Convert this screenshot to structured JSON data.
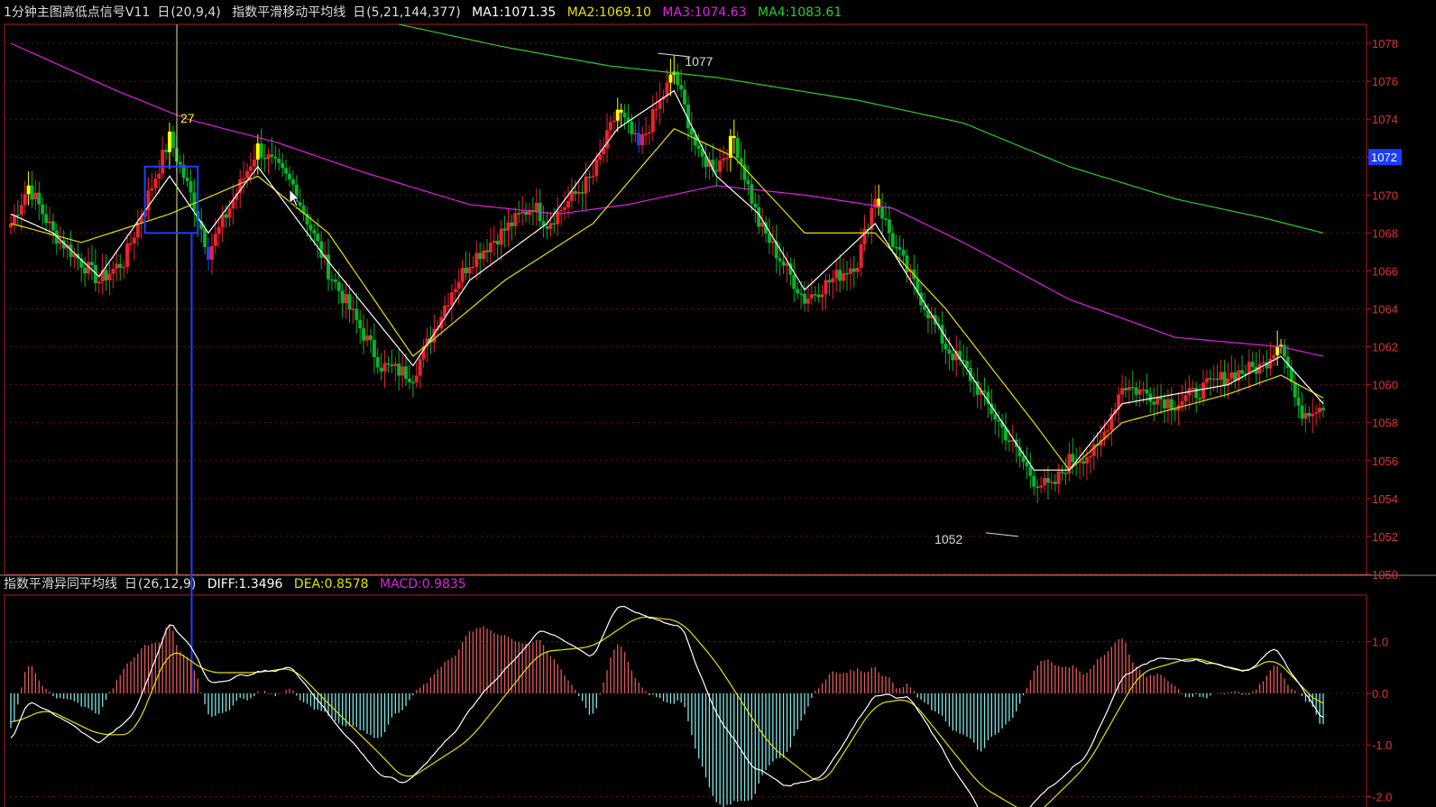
{
  "colors": {
    "up": "#e8232e",
    "down": "#0bb02e",
    "yellow": "#ffff00",
    "blue": "#1e40ff",
    "ma1": "#ffffff",
    "ma2": "#e6e200",
    "ma3": "#e020e0",
    "ma4": "#2dcc2d",
    "grid": "#7a1010",
    "axis": "#b31b1b",
    "histUp": "#e05a5a",
    "histDown": "#7fe6e6",
    "label": "#dcdcdc",
    "cursor": "#e8e8a0",
    "priceTag": "#1a3cff"
  },
  "header_main": {
    "title": "1分钟主图高低点信号V11",
    "params1": "(20,9,4)",
    "indicator": "指数平滑移动平均线",
    "params2": "(5,21,144,377)",
    "ma1": "MA1:1071.35",
    "ma2": "MA2:1069.10",
    "ma3": "MA3:1074.63",
    "ma4": "MA4:1083.61",
    "checkbox_glyph": "日"
  },
  "header_sub": {
    "title": "指数平滑异同平均线",
    "params": "(26,12,9)",
    "diff": "DIFF:1.3496",
    "dea": "DEA:0.8578",
    "macd": "MACD:0.9835",
    "checkbox_glyph": "日"
  },
  "chart_data": [
    {
      "type": "candlestick",
      "ylim": [
        1050,
        1079
      ],
      "y_ticks": [
        1050,
        1052,
        1054,
        1056,
        1058,
        1060,
        1062,
        1064,
        1066,
        1068,
        1070,
        1072,
        1074,
        1076,
        1078
      ],
      "current_price_tag": "1072",
      "annotations": [
        {
          "text": "27",
          "bar_index": 45,
          "value": 1074
        },
        {
          "text": "1077",
          "bar_index": 188,
          "value": 1077
        },
        {
          "text": "1052",
          "bar_index": 281,
          "value": 1052
        }
      ],
      "close_path": [
        [
          0,
          1068.5
        ],
        [
          5,
          1070.5
        ],
        [
          12,
          1068
        ],
        [
          25,
          1065.5
        ],
        [
          32,
          1066.5
        ],
        [
          45,
          1073
        ],
        [
          52,
          1069.5
        ],
        [
          56,
          1067
        ],
        [
          70,
          1072.5
        ],
        [
          80,
          1070.5
        ],
        [
          90,
          1066
        ],
        [
          105,
          1061
        ],
        [
          114,
          1060.5
        ],
        [
          125,
          1065
        ],
        [
          130,
          1066.5
        ],
        [
          148,
          1069.5
        ],
        [
          152,
          1068.5
        ],
        [
          165,
          1071
        ],
        [
          172,
          1074.5
        ],
        [
          178,
          1072.5
        ],
        [
          188,
          1076.5
        ],
        [
          195,
          1072
        ],
        [
          200,
          1071.5
        ],
        [
          205,
          1073
        ],
        [
          212,
          1068.5
        ],
        [
          225,
          1064.5
        ],
        [
          240,
          1066.5
        ],
        [
          245,
          1070
        ],
        [
          250,
          1067.5
        ],
        [
          265,
          1062
        ],
        [
          270,
          1061
        ],
        [
          290,
          1055
        ],
        [
          295,
          1054.5
        ],
        [
          300,
          1056
        ],
        [
          308,
          1056.5
        ],
        [
          315,
          1060
        ],
        [
          330,
          1059
        ],
        [
          345,
          1060.5
        ],
        [
          355,
          1061
        ],
        [
          360,
          1062.5
        ],
        [
          365,
          1058.5
        ],
        [
          372,
          1059
        ]
      ],
      "ma1": [
        [
          0,
          1069
        ],
        [
          12,
          1068
        ],
        [
          25,
          1065.7
        ],
        [
          45,
          1071
        ],
        [
          56,
          1068
        ],
        [
          70,
          1071.5
        ],
        [
          90,
          1066.5
        ],
        [
          114,
          1061
        ],
        [
          130,
          1065.5
        ],
        [
          152,
          1068.5
        ],
        [
          172,
          1073.5
        ],
        [
          188,
          1075.5
        ],
        [
          200,
          1071
        ],
        [
          212,
          1069
        ],
        [
          225,
          1065
        ],
        [
          245,
          1068.5
        ],
        [
          265,
          1062.5
        ],
        [
          290,
          1055.5
        ],
        [
          300,
          1055.5
        ],
        [
          315,
          1059
        ],
        [
          345,
          1060
        ],
        [
          360,
          1061.5
        ],
        [
          372,
          1059
        ]
      ],
      "ma2": [
        [
          0,
          1068.5
        ],
        [
          20,
          1067.5
        ],
        [
          45,
          1069
        ],
        [
          70,
          1071
        ],
        [
          90,
          1068
        ],
        [
          114,
          1061.5
        ],
        [
          140,
          1065.5
        ],
        [
          165,
          1068.5
        ],
        [
          188,
          1073.5
        ],
        [
          205,
          1072
        ],
        [
          225,
          1068
        ],
        [
          245,
          1068
        ],
        [
          265,
          1064
        ],
        [
          290,
          1058
        ],
        [
          300,
          1055.5
        ],
        [
          315,
          1058
        ],
        [
          345,
          1059.5
        ],
        [
          360,
          1060.5
        ],
        [
          372,
          1059.3
        ]
      ],
      "ma3": [
        [
          0,
          1078
        ],
        [
          30,
          1075.5
        ],
        [
          50,
          1074
        ],
        [
          75,
          1072.8
        ],
        [
          100,
          1071.2
        ],
        [
          130,
          1069.5
        ],
        [
          155,
          1069
        ],
        [
          175,
          1069.5
        ],
        [
          200,
          1070.5
        ],
        [
          225,
          1070
        ],
        [
          250,
          1069.3
        ],
        [
          270,
          1067.5
        ],
        [
          300,
          1064.5
        ],
        [
          330,
          1062.5
        ],
        [
          360,
          1062
        ],
        [
          372,
          1061.5
        ]
      ],
      "ma4": [
        [
          110,
          1079
        ],
        [
          140,
          1077.8
        ],
        [
          170,
          1076.8
        ],
        [
          200,
          1076.2
        ],
        [
          240,
          1075
        ],
        [
          270,
          1073.8
        ],
        [
          300,
          1071.5
        ],
        [
          330,
          1069.8
        ],
        [
          355,
          1068.8
        ],
        [
          372,
          1068
        ]
      ]
    },
    {
      "type": "macd",
      "ylim": [
        -2.2,
        1.9
      ],
      "y_ticks": [
        1.0,
        0.0,
        -1.0,
        -2.0
      ],
      "diff_path": [
        [
          0,
          -0.9
        ],
        [
          5,
          -0.2
        ],
        [
          10,
          -0.3
        ],
        [
          25,
          -0.95
        ],
        [
          35,
          -0.4
        ],
        [
          45,
          1.4
        ],
        [
          52,
          0.8
        ],
        [
          56,
          0.2
        ],
        [
          70,
          0.4
        ],
        [
          80,
          0.5
        ],
        [
          90,
          -0.4
        ],
        [
          105,
          -1.6
        ],
        [
          112,
          -1.75
        ],
        [
          125,
          -0.8
        ],
        [
          135,
          0.1
        ],
        [
          150,
          1.2
        ],
        [
          155,
          1.1
        ],
        [
          165,
          0.7
        ],
        [
          172,
          1.7
        ],
        [
          180,
          1.5
        ],
        [
          190,
          1.3
        ],
        [
          200,
          -0.4
        ],
        [
          210,
          -1.4
        ],
        [
          220,
          -1.8
        ],
        [
          230,
          -1.6
        ],
        [
          245,
          0
        ],
        [
          255,
          -0.1
        ],
        [
          265,
          -1.2
        ],
        [
          275,
          -2.3
        ],
        [
          285,
          -2.4
        ],
        [
          295,
          -1.8
        ],
        [
          305,
          -1.2
        ],
        [
          315,
          0.3
        ],
        [
          325,
          0.7
        ],
        [
          340,
          0.6
        ],
        [
          350,
          0.4
        ],
        [
          358,
          0.9
        ],
        [
          372,
          -0.5
        ]
      ],
      "dea_path": [
        [
          0,
          -0.6
        ],
        [
          10,
          -0.3
        ],
        [
          25,
          -0.8
        ],
        [
          35,
          -0.8
        ],
        [
          45,
          0.9
        ],
        [
          56,
          0.4
        ],
        [
          70,
          0.4
        ],
        [
          80,
          0.5
        ],
        [
          90,
          -0.2
        ],
        [
          105,
          -1.2
        ],
        [
          112,
          -1.7
        ],
        [
          130,
          -0.9
        ],
        [
          150,
          0.8
        ],
        [
          165,
          0.9
        ],
        [
          178,
          1.5
        ],
        [
          190,
          1.4
        ],
        [
          200,
          0.6
        ],
        [
          215,
          -1.0
        ],
        [
          230,
          -1.8
        ],
        [
          245,
          -0.2
        ],
        [
          255,
          -0.1
        ],
        [
          275,
          -1.8
        ],
        [
          290,
          -2.4
        ],
        [
          305,
          -1.4
        ],
        [
          320,
          0.4
        ],
        [
          335,
          0.7
        ],
        [
          350,
          0.4
        ],
        [
          358,
          0.7
        ],
        [
          372,
          -0.3
        ]
      ]
    }
  ]
}
